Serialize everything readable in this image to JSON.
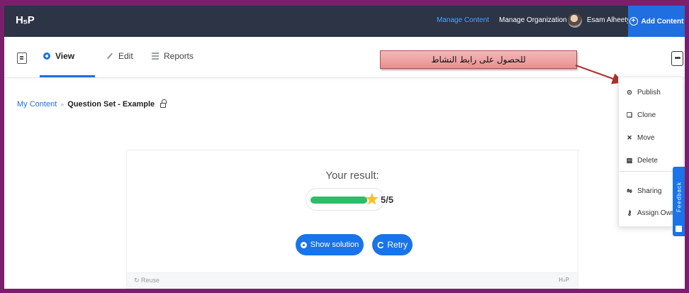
{
  "topbar": {
    "logo": "H₅P",
    "manage_content": "Manage Content",
    "manage_organization": "Manage Organization",
    "user_name": "Esam Alheety ▾",
    "add_content": "Add Content"
  },
  "tabs": {
    "view": "View",
    "edit": "Edit",
    "reports": "Reports"
  },
  "more_button": "•••",
  "annotation": "للحصول على رابط النشاط",
  "breadcrumb": {
    "root": "My Content",
    "separator": "»",
    "current": "Question Set - Example"
  },
  "result": {
    "title": "Your result:",
    "score_text": "5/5",
    "score_fraction": 1.0,
    "show_solution": "Show solution",
    "retry": "Retry",
    "reuse": "Reuse",
    "footer_logo": "H₅P"
  },
  "menu": {
    "publish": "Publish",
    "clone": "Clone",
    "move": "Move",
    "delete": "Delete",
    "sharing": "Sharing",
    "assign_owner": "Assign Owner"
  },
  "feedback": "Feedback",
  "colors": {
    "frame": "#7a1f6c",
    "topbar": "#2c3446",
    "accent": "#1a73e8",
    "progress": "#2ebc6a",
    "callout": "#e88f8f"
  }
}
